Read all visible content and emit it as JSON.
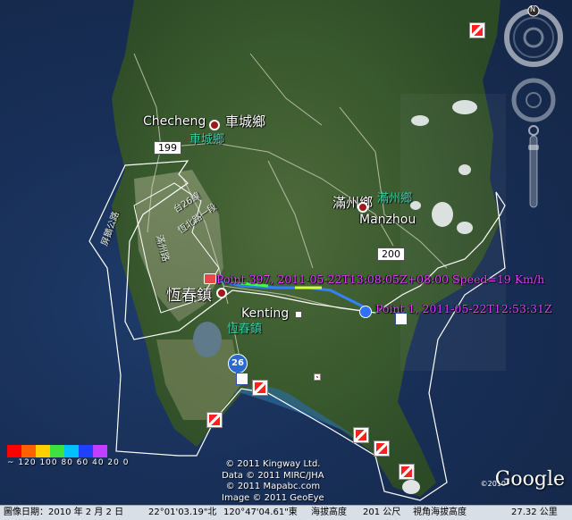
{
  "map": {
    "towns": [
      {
        "en": "Checheng",
        "cn": "車城鄉",
        "cn_green": "車城鄉"
      },
      {
        "en": "Manzhou",
        "cn": "滿州鄉",
        "cn_green": "滿州鄉"
      },
      {
        "en": "Kenting",
        "cn": "",
        "cn_green": ""
      },
      {
        "en": "",
        "cn": "恆春鎮",
        "cn_green": "恆春鎮"
      }
    ],
    "road_shields": [
      "199",
      "200",
      "26"
    ],
    "road_labels": [
      "屏鵝公路",
      "台26線",
      "恆北路一段",
      "滿州路"
    ],
    "track_points": [
      {
        "label": "Point 397, 2011-05-22T13:08:05Z+08:00 Speed=19 Km/h"
      },
      {
        "label": "Point 1, 2011-05-22T12:53:31Z"
      }
    ],
    "legend": {
      "colors": [
        "#ff0000",
        "#ff6000",
        "#ffd000",
        "#40e040",
        "#00c0ff",
        "#2040ff",
        "#c040ff"
      ],
      "labels": "~ 120 100 80 60 40 20  0"
    },
    "credits": [
      "© 2011 Kingway Ltd.",
      "Data © 2011 MIRC/JHA",
      "© 2011 Mapabc.com",
      "Image © 2011 GeoEye"
    ],
    "brand": "Google",
    "brand_year": "©2010",
    "nav_compass_label": "N"
  },
  "status": {
    "image_date_label": "圖像日期：2010 年 2 月  2 日",
    "lat": "22°01'03.19\"北",
    "lon": "120°47'04.61\"東",
    "elevation_label": "海拔高度",
    "elevation_value": "201 公尺",
    "eye_alt_label": "視角海拔高度",
    "eye_alt_value": "27.32 公里"
  }
}
